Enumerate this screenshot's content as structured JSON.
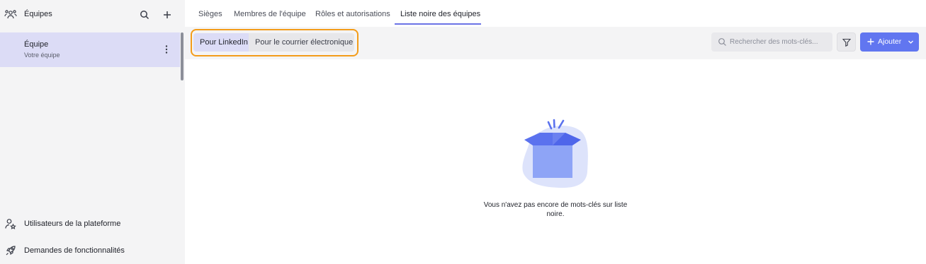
{
  "sidebar": {
    "title": "Équipes",
    "team": {
      "name": "Équipe",
      "subtitle": "Votre équipe"
    },
    "footer": [
      {
        "label": "Utilisateurs de la plateforme",
        "icon": "user-star-icon"
      },
      {
        "label": "Demandes de fonctionnalités",
        "icon": "rocket-icon"
      }
    ]
  },
  "tabs": [
    {
      "label": "Sièges"
    },
    {
      "label": "Membres de l'équipe"
    },
    {
      "label": "Rôles et autorisations"
    },
    {
      "label": "Liste noire des équipes",
      "active": true
    }
  ],
  "toolbar": {
    "segments": [
      {
        "label": "Pour LinkedIn",
        "active": true
      },
      {
        "label": "Pour le courrier électronique",
        "active": false
      }
    ],
    "search_placeholder": "Rechercher des mots-clés...",
    "add_label": "Ajouter"
  },
  "empty_state": {
    "message": "Vous n'avez pas encore de mots-clés sur liste noire."
  },
  "colors": {
    "accent": "#6176f0",
    "highlight": "#f39c1a",
    "selected_bg": "#dcdcf6",
    "sidebar_bg": "#f4f4f5"
  }
}
